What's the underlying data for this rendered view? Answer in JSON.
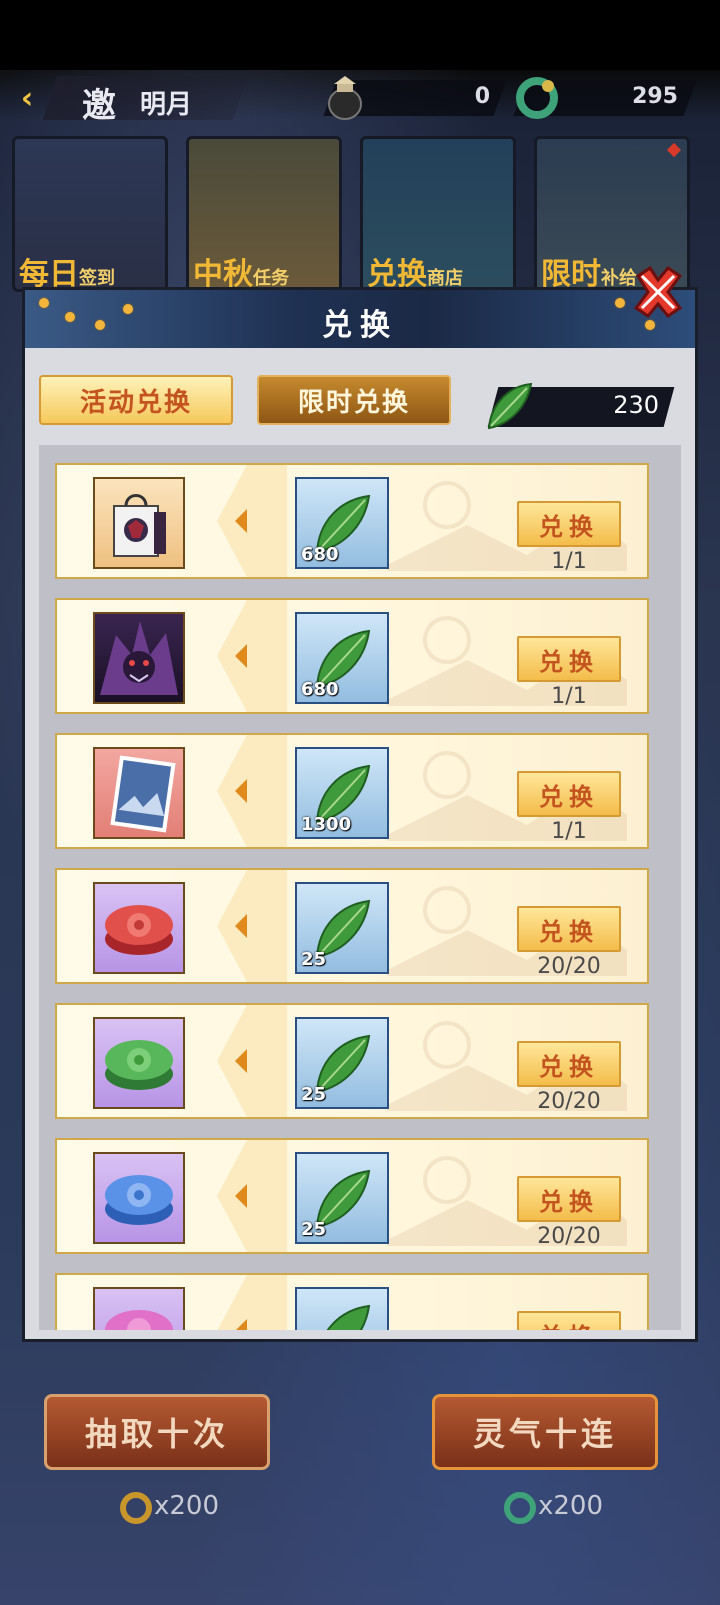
{
  "header": {
    "title_char": "邀",
    "title_sub": "明月",
    "resource_1": "0",
    "resource_2": "295"
  },
  "banners": [
    {
      "main": "每日",
      "sub": "签到"
    },
    {
      "main": "中秋",
      "sub": "任务"
    },
    {
      "main": "兑换",
      "sub": "商店"
    },
    {
      "main": "限时",
      "sub": "补给"
    }
  ],
  "modal": {
    "title": "兑换",
    "tabs": [
      "活动兑换",
      "限时兑换"
    ],
    "currency": "230",
    "button_label": "兑换"
  },
  "rows": [
    {
      "item": "gift-bag",
      "cost": "680",
      "limit": "1/1"
    },
    {
      "item": "dragon-portrait",
      "cost": "680",
      "limit": "1/1"
    },
    {
      "item": "scenery-card",
      "cost": "1300",
      "limit": "1/1"
    },
    {
      "item": "red-mooncake",
      "cost": "25",
      "limit": "20/20"
    },
    {
      "item": "green-mooncake",
      "cost": "25",
      "limit": "20/20"
    },
    {
      "item": "blue-mooncake",
      "cost": "25",
      "limit": "20/20"
    },
    {
      "item": "pink-mooncake",
      "cost": "",
      "limit": ""
    }
  ],
  "bottom": {
    "left_button": "抽取十次",
    "right_button": "灵气十连",
    "left_cost": "x200",
    "right_cost": "x200"
  },
  "colors": {
    "tab_text": "#c4541f",
    "gold": "#f0b835",
    "leaf_green": "#3e9a3a"
  }
}
